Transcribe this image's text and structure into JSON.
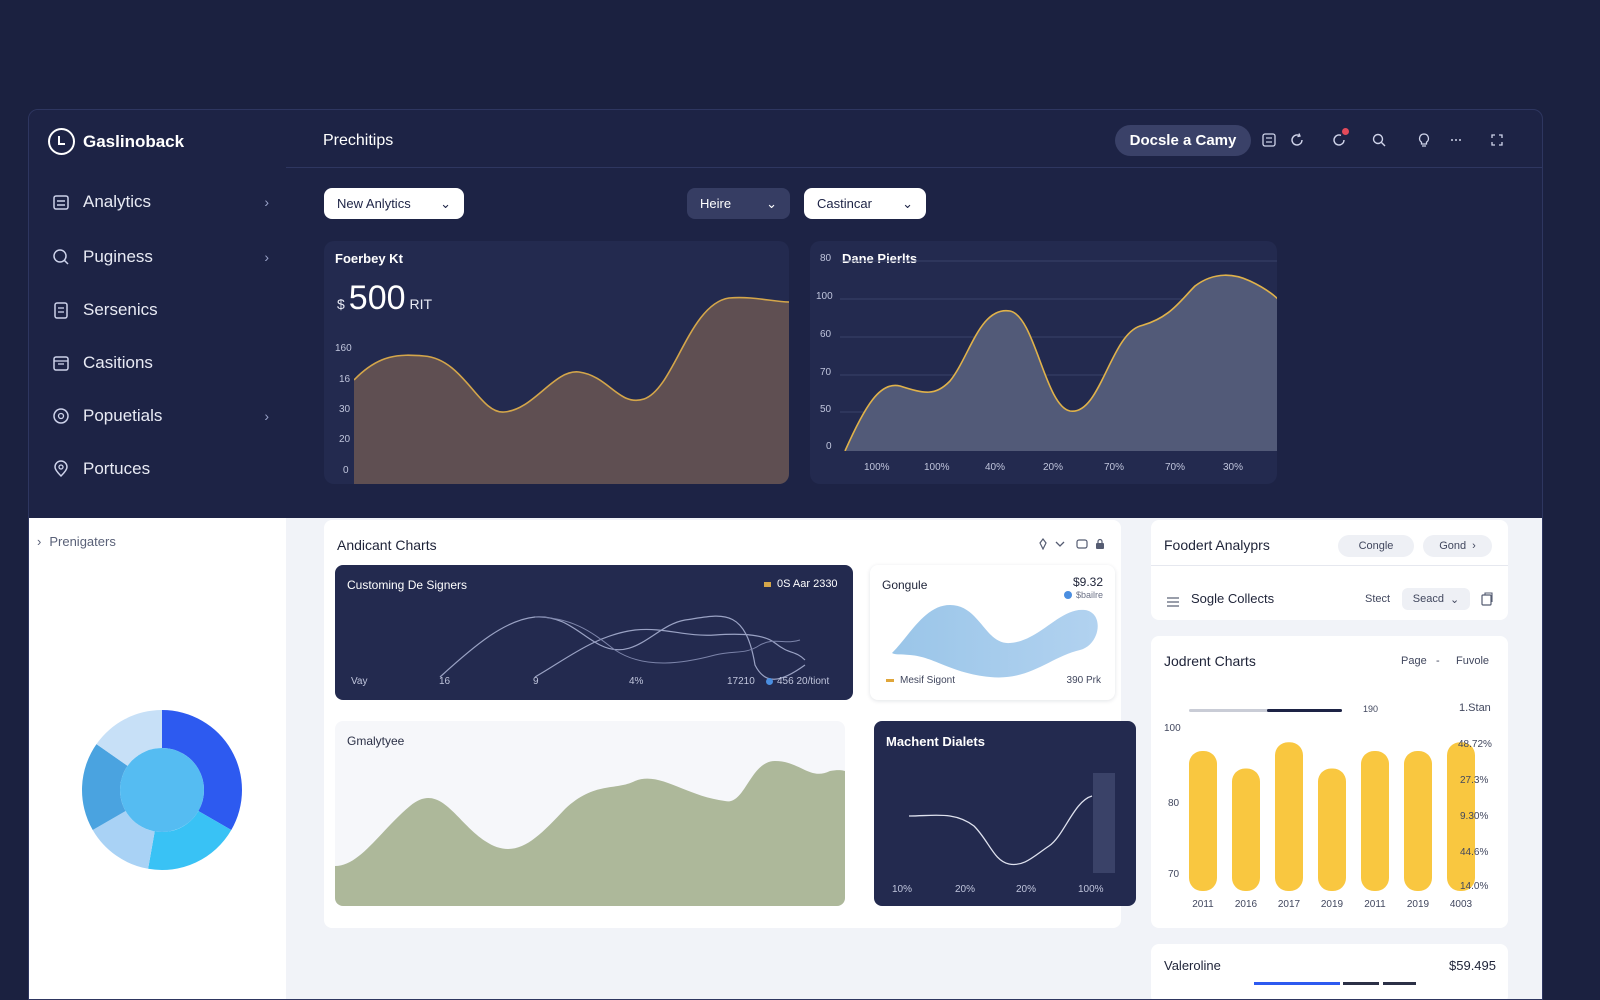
{
  "brand": {
    "name": "Gaslinoback",
    "logo_icon": "brand-logo-icon"
  },
  "sidebar": {
    "items": [
      {
        "label": "Analytics",
        "icon": "building-icon",
        "chevron": true
      },
      {
        "label": "Puginess",
        "icon": "search-globe-icon",
        "chevron": true
      },
      {
        "label": "Sersenics",
        "icon": "clipboard-icon",
        "chevron": false
      },
      {
        "label": "Casitions",
        "icon": "calendar-icon",
        "chevron": false
      },
      {
        "label": "Popuetials",
        "icon": "settings-icon",
        "chevron": true
      },
      {
        "label": "Portuces",
        "icon": "location-icon",
        "chevron": false
      }
    ],
    "pre_nav_label": "Prenigaters"
  },
  "header": {
    "title": "Prechitips",
    "cta_label": "Docsle a Camy",
    "icons": [
      "list-icon",
      "refresh-icon",
      "notification-icon",
      "search-icon",
      "bulb-icon",
      "more-icon",
      "expand-icon"
    ]
  },
  "filters": {
    "analytics": "New Anlytics",
    "range": "Heire",
    "category": "Castincar"
  },
  "kpi_chart": {
    "title": "Foerbey Kt",
    "currency": "$",
    "value": "500",
    "unit": "RIT",
    "yticks": [
      "160",
      "16",
      "30",
      "20",
      "0"
    ],
    "fill": "#6b5a5a",
    "stroke": "#d4a64a"
  },
  "dane_chart": {
    "title": "Dane Pierlts",
    "yticks": [
      "80",
      "100",
      "60",
      "70",
      "50",
      "0"
    ],
    "xticks": [
      "100%",
      "100%",
      "40%",
      "20%",
      "70%",
      "70%",
      "30%"
    ],
    "fill": "#5a6280",
    "stroke": "#e0b24a"
  },
  "andicant": {
    "title": "Andicant Charts",
    "icons": [
      "pin-icon",
      "chevron-down-icon",
      "message-icon",
      "lock-icon"
    ],
    "customing": {
      "title": "Customing De Signers",
      "legend": "0S Aar 2330",
      "xlabels": [
        "Vay",
        "16",
        "9",
        "4%",
        "17210"
      ],
      "footer_legend": "456 20/tiont"
    },
    "gongule": {
      "title": "Gongule",
      "value": "$9.32",
      "sub": "$bailre",
      "legend": "Mesif Sigont",
      "footer": "390 Prk"
    },
    "smaly": {
      "title": "Gmalytyee"
    },
    "machent": {
      "title": "Machent Dialets",
      "xlabels": [
        "10%",
        "20%",
        "20%",
        "100%"
      ]
    }
  },
  "foodert": {
    "title": "Foodert Analyprs",
    "tab1": "Congle",
    "tab2": "Gond",
    "row_label": "Sogle Collects",
    "select_label": "Stect",
    "select_value": "Seacd"
  },
  "jodrent": {
    "title": "Jodrent Charts",
    "page_label": "Page",
    "fav_label": "Fuvole",
    "progress_label": "190",
    "right_labels": [
      "1.Stan",
      "48.72%",
      "27.3%",
      "9.30%",
      "44.6%",
      "14.0%"
    ],
    "yticks": [
      "100",
      "80",
      "70"
    ],
    "accent": "#f9c740"
  },
  "chart_data": [
    {
      "type": "bar",
      "title": "Jodrent Charts",
      "categories": [
        "2011",
        "2016",
        "2017",
        "2019",
        "2011",
        "2019",
        "4003"
      ],
      "values": [
        96,
        92,
        98,
        92,
        96,
        96,
        98
      ],
      "ylim": [
        64,
        104
      ]
    }
  ],
  "valeroline": {
    "title": "Valeroline",
    "value": "$59.495"
  },
  "donut": {
    "colors": [
      "#2d5af0",
      "#39c2f5",
      "#a9d2f5",
      "#4aa3e0",
      "#c7e0f7",
      "#55bcf2"
    ]
  }
}
